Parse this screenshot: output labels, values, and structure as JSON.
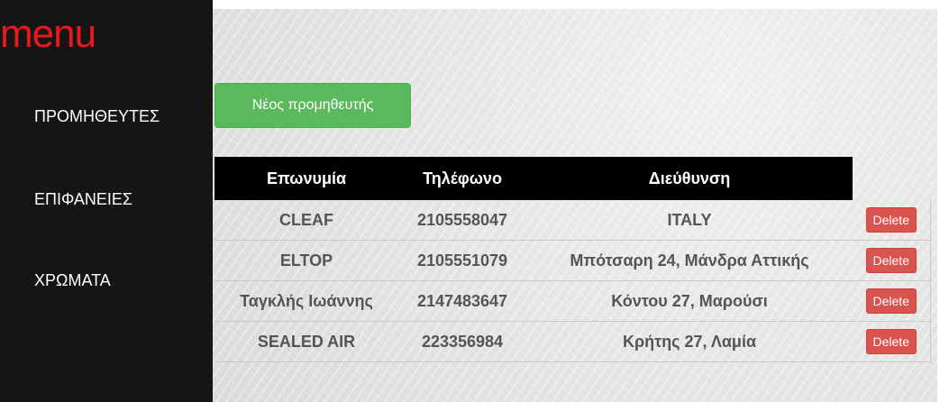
{
  "sidebar": {
    "title": "menu",
    "items": [
      {
        "label": "ΠΡΟΜΗΘΕΥΤΕΣ"
      },
      {
        "label": "ΕΠΙΦΑΝΕΙΕΣ"
      },
      {
        "label": "ΧΡΩΜΑΤΑ"
      }
    ]
  },
  "main": {
    "new_button_label": "Νέος προμηθευτής",
    "table": {
      "headers": [
        "Επωνυμία",
        "Τηλέφωνο",
        "Διεύθυνση"
      ],
      "rows": [
        {
          "name": "CLEAF",
          "phone": "2105558047",
          "address": "ITALY",
          "action": "Delete"
        },
        {
          "name": "ELTOP",
          "phone": "2105551079",
          "address": "Μπότσαρη 24, Μάνδρα Αττικής",
          "action": "Delete"
        },
        {
          "name": "Ταγκλής Ιωάννης",
          "phone": "2147483647",
          "address": "Κόντου 27, Μαρούσι",
          "action": "Delete"
        },
        {
          "name": "SEALED AIR",
          "phone": "223356984",
          "address": "Κρήτης 27, Λαμία",
          "action": "Delete"
        }
      ]
    }
  },
  "colors": {
    "sidebar_bg": "#151515",
    "menu_title": "#e8191e",
    "success": "#5cb85c",
    "danger": "#d9534f",
    "header_bg": "#000000"
  }
}
